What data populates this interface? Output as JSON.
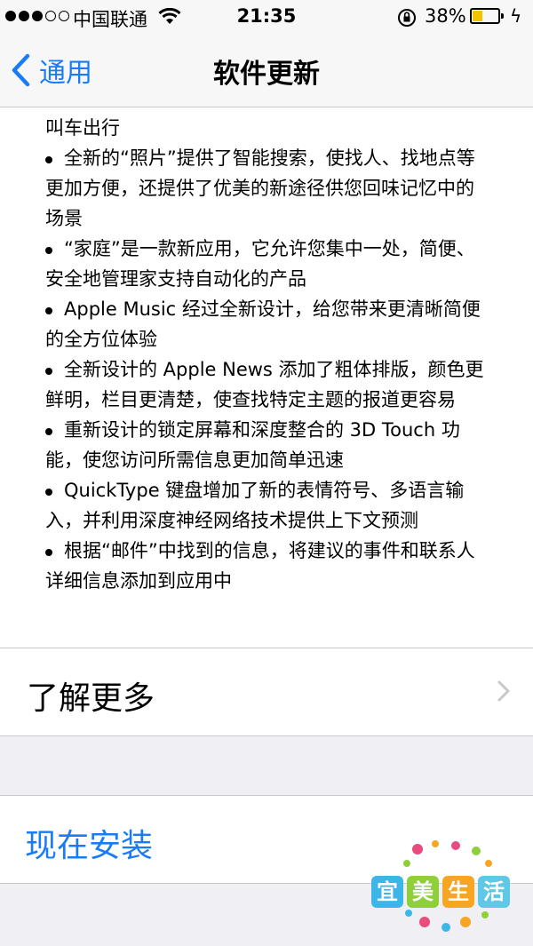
{
  "status_bar": {
    "carrier": "中国联通",
    "time": "21:35",
    "battery_percent": "38%",
    "battery_level": 0.38,
    "signal_bars_filled": 3,
    "signal_bars_total": 5
  },
  "nav": {
    "back_label": "通用",
    "title": "软件更新"
  },
  "notes": {
    "lines": [
      {
        "text": "叫车出行",
        "bullet": false
      },
      {
        "text": "全新的“照片”提供了智能搜索，使找人、找地点等",
        "bullet": true
      },
      {
        "text": "更加方便，还提供了优美的新途径供您回味记忆中的",
        "bullet": false
      },
      {
        "text": "场景",
        "bullet": false
      },
      {
        "text": "“家庭”是一款新应用，它允许您集中一处，简便、",
        "bullet": true
      },
      {
        "text": "安全地管理家支持自动化的产品",
        "bullet": false
      },
      {
        "text": "Apple Music 经过全新设计，给您带来更清晰简便",
        "bullet": true
      },
      {
        "text": "的全方位体验",
        "bullet": false
      },
      {
        "text": "全新设计的 Apple News 添加了粗体排版，颜色更",
        "bullet": true
      },
      {
        "text": "鲜明，栏目更清楚，使查找特定主题的报道更容易",
        "bullet": false
      },
      {
        "text": "重新设计的锁定屏幕和深度整合的 3D Touch 功",
        "bullet": true
      },
      {
        "text": "能，使您访问所需信息更加简单迅速",
        "bullet": false
      },
      {
        "text": "QuickType 键盘增加了新的表情符号、多语言输",
        "bullet": true
      },
      {
        "text": "入，并利用深度神经网络技术提供上下文预测",
        "bullet": false
      },
      {
        "text": "根据“邮件”中找到的信息，将建议的事件和联系人",
        "bullet": true
      },
      {
        "text": "详细信息添加到应用中",
        "bullet": false
      }
    ]
  },
  "learn_more": {
    "label": "了解更多"
  },
  "install": {
    "label": "现在安装"
  },
  "watermark": {
    "chars": [
      "宜",
      "美",
      "生",
      "活"
    ],
    "colors": [
      "#3cb6e8",
      "#8fcf3a",
      "#f6a623",
      "#5ec8e6"
    ]
  },
  "colors": {
    "accent": "#1a7cf5",
    "battery_fill": "#f5c400",
    "background": "#efeff4"
  },
  "icons": {
    "back": "chevron-left-icon",
    "wifi": "wifi-icon",
    "rotation_lock": "rotation-lock-icon",
    "battery": "battery-icon",
    "charging": "lightning-icon",
    "disclosure": "chevron-right-icon"
  }
}
